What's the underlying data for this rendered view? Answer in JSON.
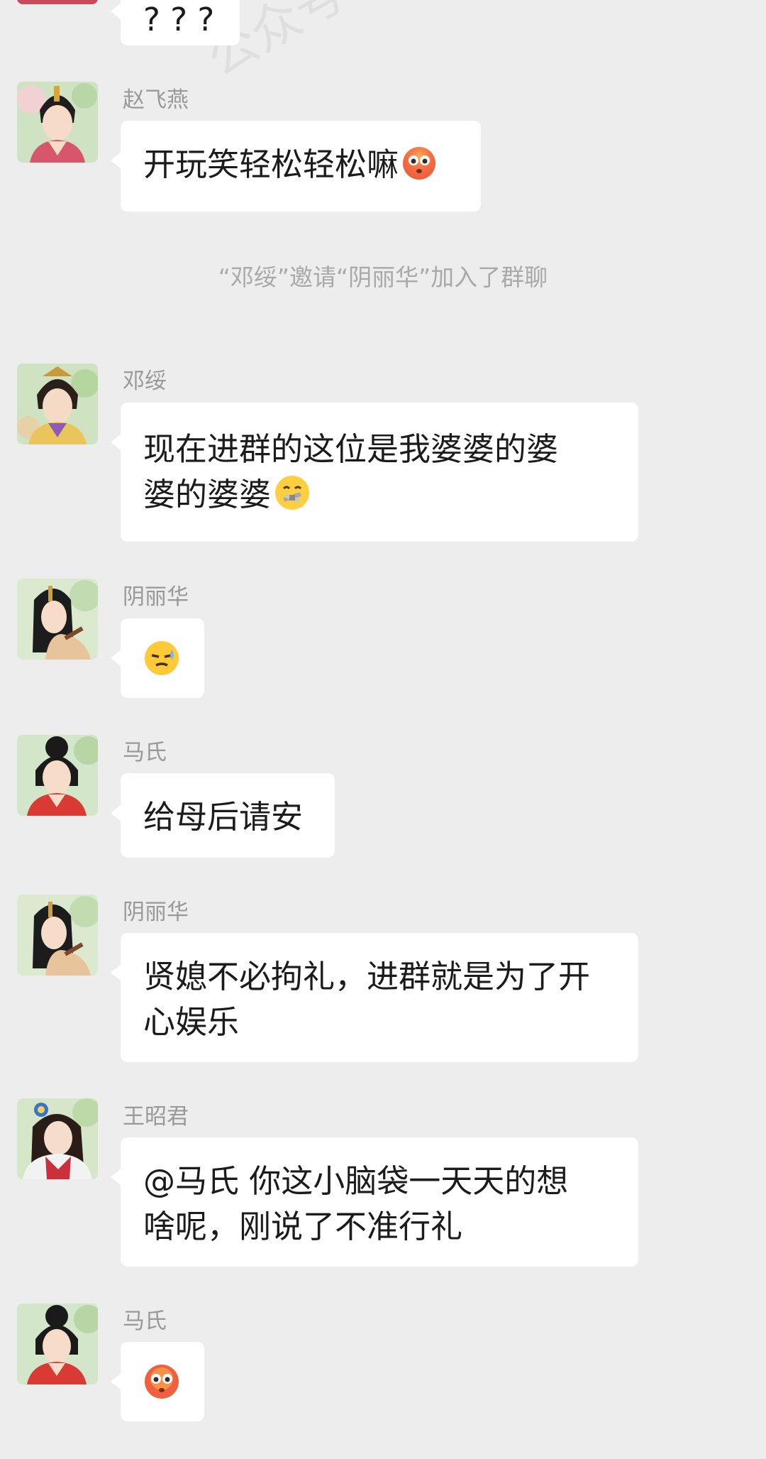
{
  "watermark": "公众号:",
  "partial_top_bubble": "? ? ?",
  "messages": [
    {
      "sender": "赵飞燕",
      "text": "开玩笑轻松轻松嘛",
      "emoji": "flushed-face-icon"
    },
    {
      "system": "“邓绥”邀请“阴丽华”加入了群聊"
    },
    {
      "sender": "邓绥",
      "line1": "现在进群的这位是我婆婆的婆",
      "line2": "婆的婆婆",
      "emoji": "zipper-mouth-face-icon"
    },
    {
      "sender": "阴丽华",
      "emoji": "unamused-face-icon"
    },
    {
      "sender": "马氏",
      "text": "给母后请安"
    },
    {
      "sender": "阴丽华",
      "line1": "贤媳不必拘礼，进群就是为了开",
      "line2": "心娱乐"
    },
    {
      "sender": "王昭君",
      "line1": "@马氏 你这小脑袋一天天的想",
      "line2": "啥呢，刚说了不准行礼"
    },
    {
      "sender": "马氏",
      "emoji": "flushed-face-icon"
    }
  ]
}
